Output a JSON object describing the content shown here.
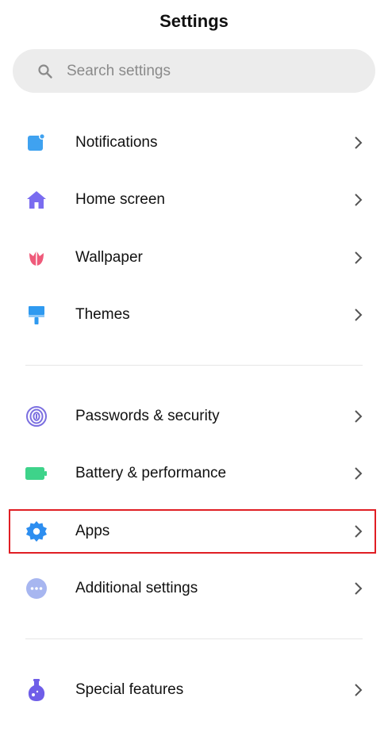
{
  "header": {
    "title": "Settings"
  },
  "search": {
    "placeholder": "Search settings",
    "icon": "search-icon"
  },
  "items": [
    {
      "label": "Notifications",
      "icon": "notifications-icon",
      "color": "#3fa2f0"
    },
    {
      "label": "Home screen",
      "icon": "home-icon",
      "color": "#7a6cf0"
    },
    {
      "label": "Wallpaper",
      "icon": "tulip-icon",
      "color": "#ef5a7a"
    },
    {
      "label": "Themes",
      "icon": "brush-icon",
      "color": "#2f9af0"
    },
    {
      "label": "Passwords & security",
      "icon": "fingerprint-icon",
      "color": "#7b6fe0"
    },
    {
      "label": "Battery & performance",
      "icon": "battery-icon",
      "color": "#3ed38a"
    },
    {
      "label": "Apps",
      "icon": "gear-icon",
      "color": "#2d8ef0"
    },
    {
      "label": "Additional settings",
      "icon": "more-icon",
      "color": "#a7b6f0"
    },
    {
      "label": "Special features",
      "icon": "flask-icon",
      "color": "#6f5ee8"
    }
  ],
  "highlight": {
    "target": "Apps",
    "color": "#e01e24"
  }
}
